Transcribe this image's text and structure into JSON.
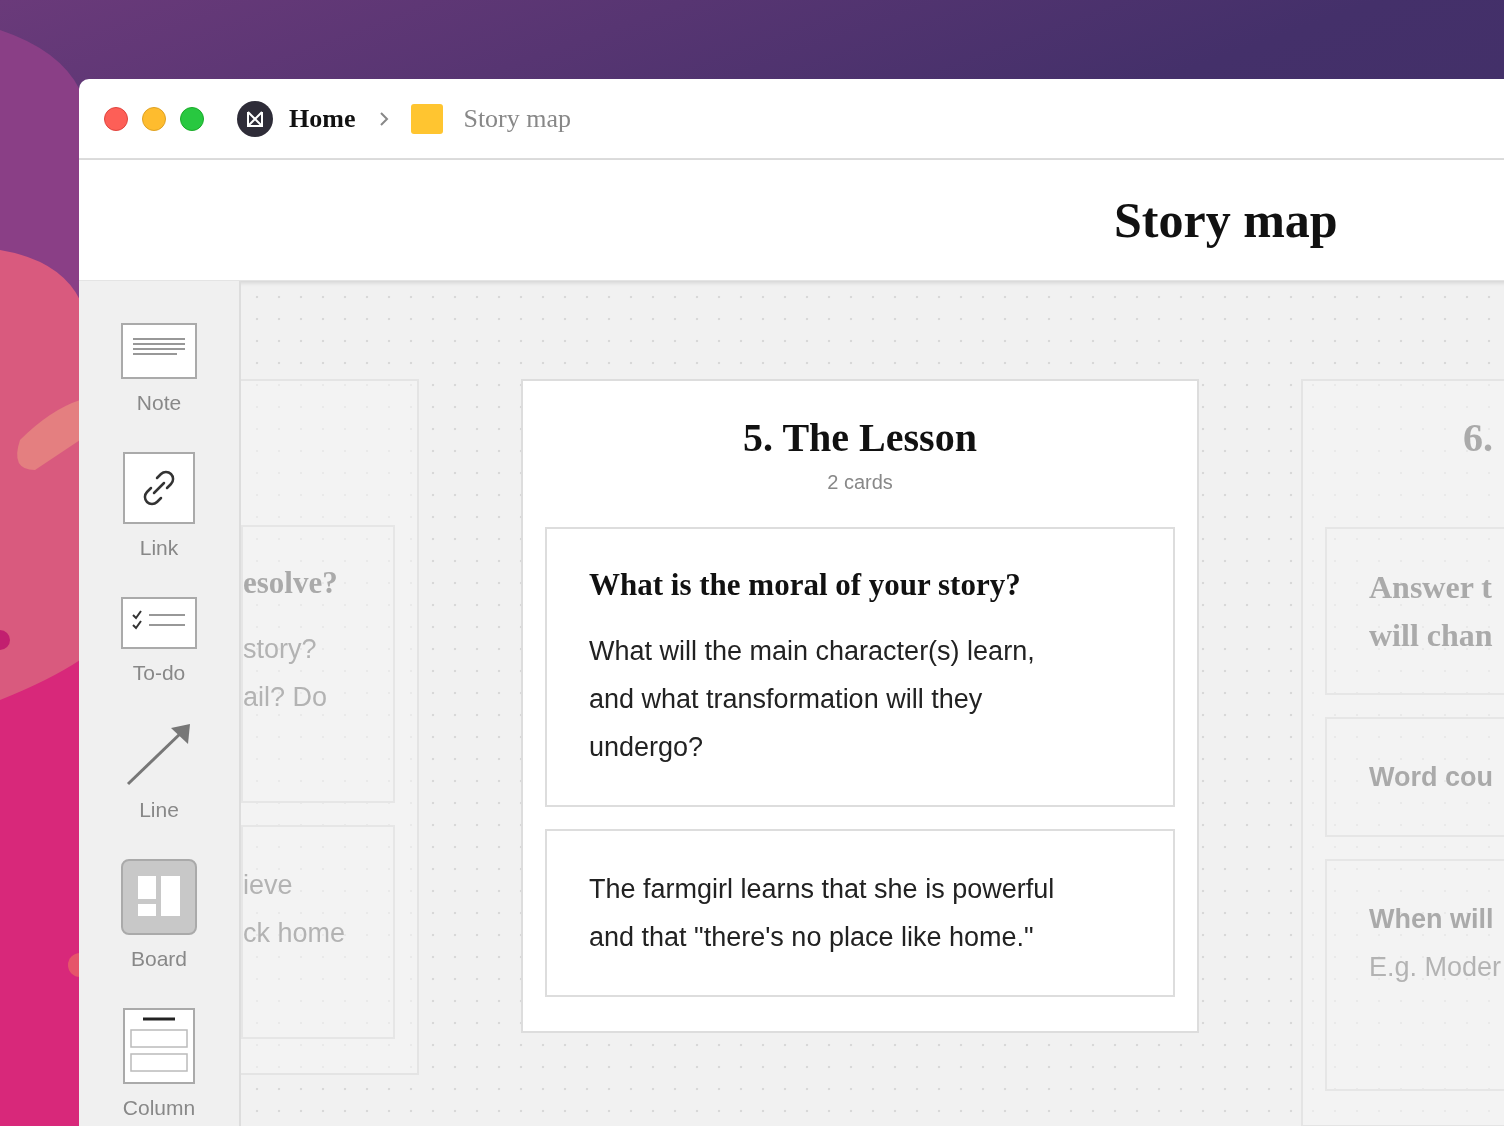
{
  "breadcrumb": {
    "home": "Home",
    "current": "Story map"
  },
  "page_title": "Story map",
  "tools": [
    {
      "kind": "note",
      "label": "Note"
    },
    {
      "kind": "link",
      "label": "Link"
    },
    {
      "kind": "todo",
      "label": "To-do"
    },
    {
      "kind": "line",
      "label": "Line"
    },
    {
      "kind": "board",
      "label": "Board"
    },
    {
      "kind": "column",
      "label": "Column"
    }
  ],
  "columns": [
    {
      "faded": true,
      "cards": [
        {
          "heading": "esolve?",
          "lines": [
            "story?",
            "ail? Do"
          ]
        },
        {
          "lines": [
            "ieve",
            "ck home"
          ]
        }
      ]
    },
    {
      "faded": false,
      "title": "5. The Lesson",
      "count": "2 cards",
      "cards": [
        {
          "heading": "What is the moral of your story?",
          "lines": [
            "What will the main character(s) learn,",
            "and what transformation will they",
            "undergo?"
          ]
        },
        {
          "lines": [
            "The farmgirl learns that she is powerful",
            "and that \"there's no place like home.\""
          ]
        }
      ]
    },
    {
      "faded": true,
      "title": "6.",
      "cards": [
        {
          "heading_lines": [
            "Answer t",
            "will chan"
          ]
        },
        {
          "title": "Word cou"
        },
        {
          "title": "When will",
          "lines": [
            "E.g. Moder"
          ]
        }
      ]
    }
  ]
}
